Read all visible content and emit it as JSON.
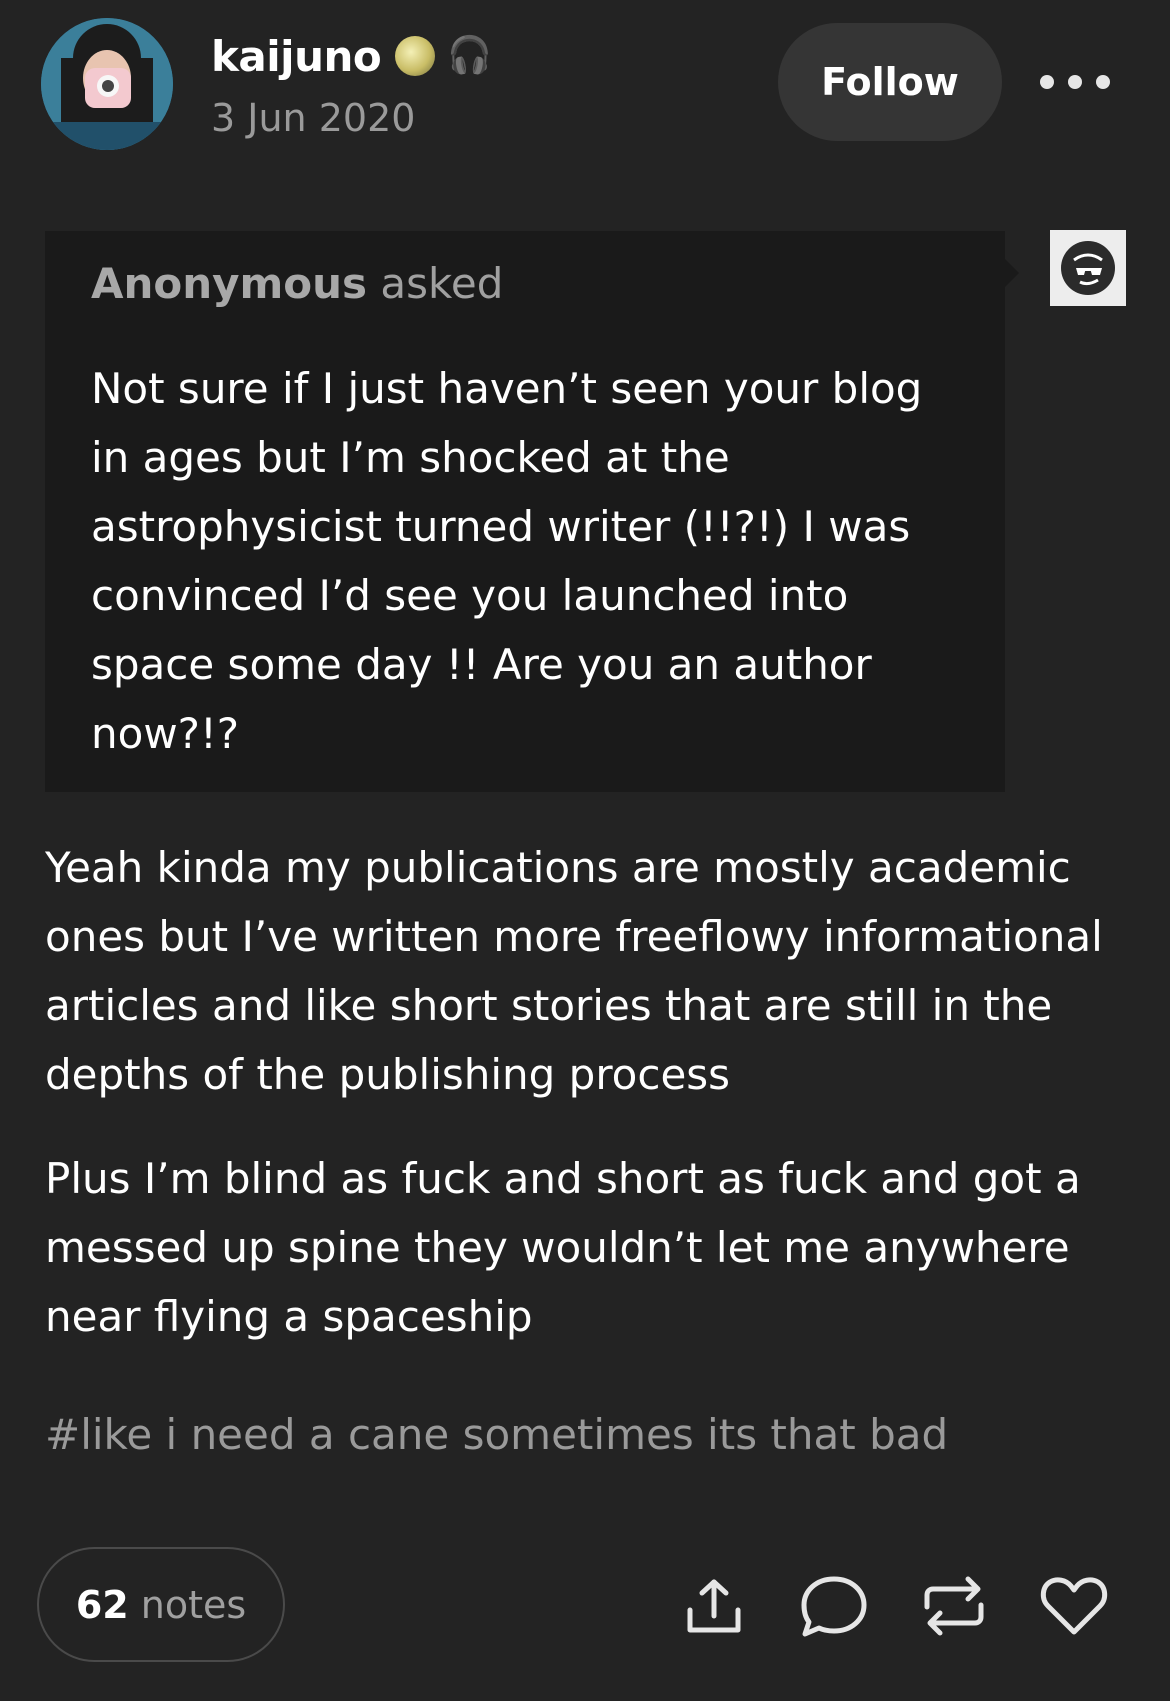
{
  "post": {
    "username": "kaijuno",
    "badge_headphones": "🎧",
    "date": "3 Jun 2020",
    "follow_label": "Follow"
  },
  "ask": {
    "asker": "Anonymous",
    "asked_label": "asked",
    "question": "Not sure if I just haven’t seen your blog in ages but I’m shocked at the astrophysicist turned writer (!!?!) I was convinced I’d see you launched into space some day !! Are you an author now?!?"
  },
  "answer": {
    "paragraphs": [
      "Yeah kinda my publications are mostly academic ones but I’ve written more freeflowy informational articles and like short stories that are still in the depths of the publishing process",
      "Plus I’m blind as fuck and short as fuck and got a messed up spine they wouldn’t let me anywhere near flying a spaceship"
    ]
  },
  "tags": [
    "#like i need a cane sometimes its that bad"
  ],
  "footer": {
    "notes_count": "62",
    "notes_label": "notes",
    "actions": [
      "share-icon",
      "reply-icon",
      "reblog-icon",
      "like-icon"
    ]
  },
  "colors": {
    "background": "#232323",
    "ask_background": "#1a1a1a",
    "muted_text": "#9a9a9a",
    "follow_button": "#353535"
  }
}
